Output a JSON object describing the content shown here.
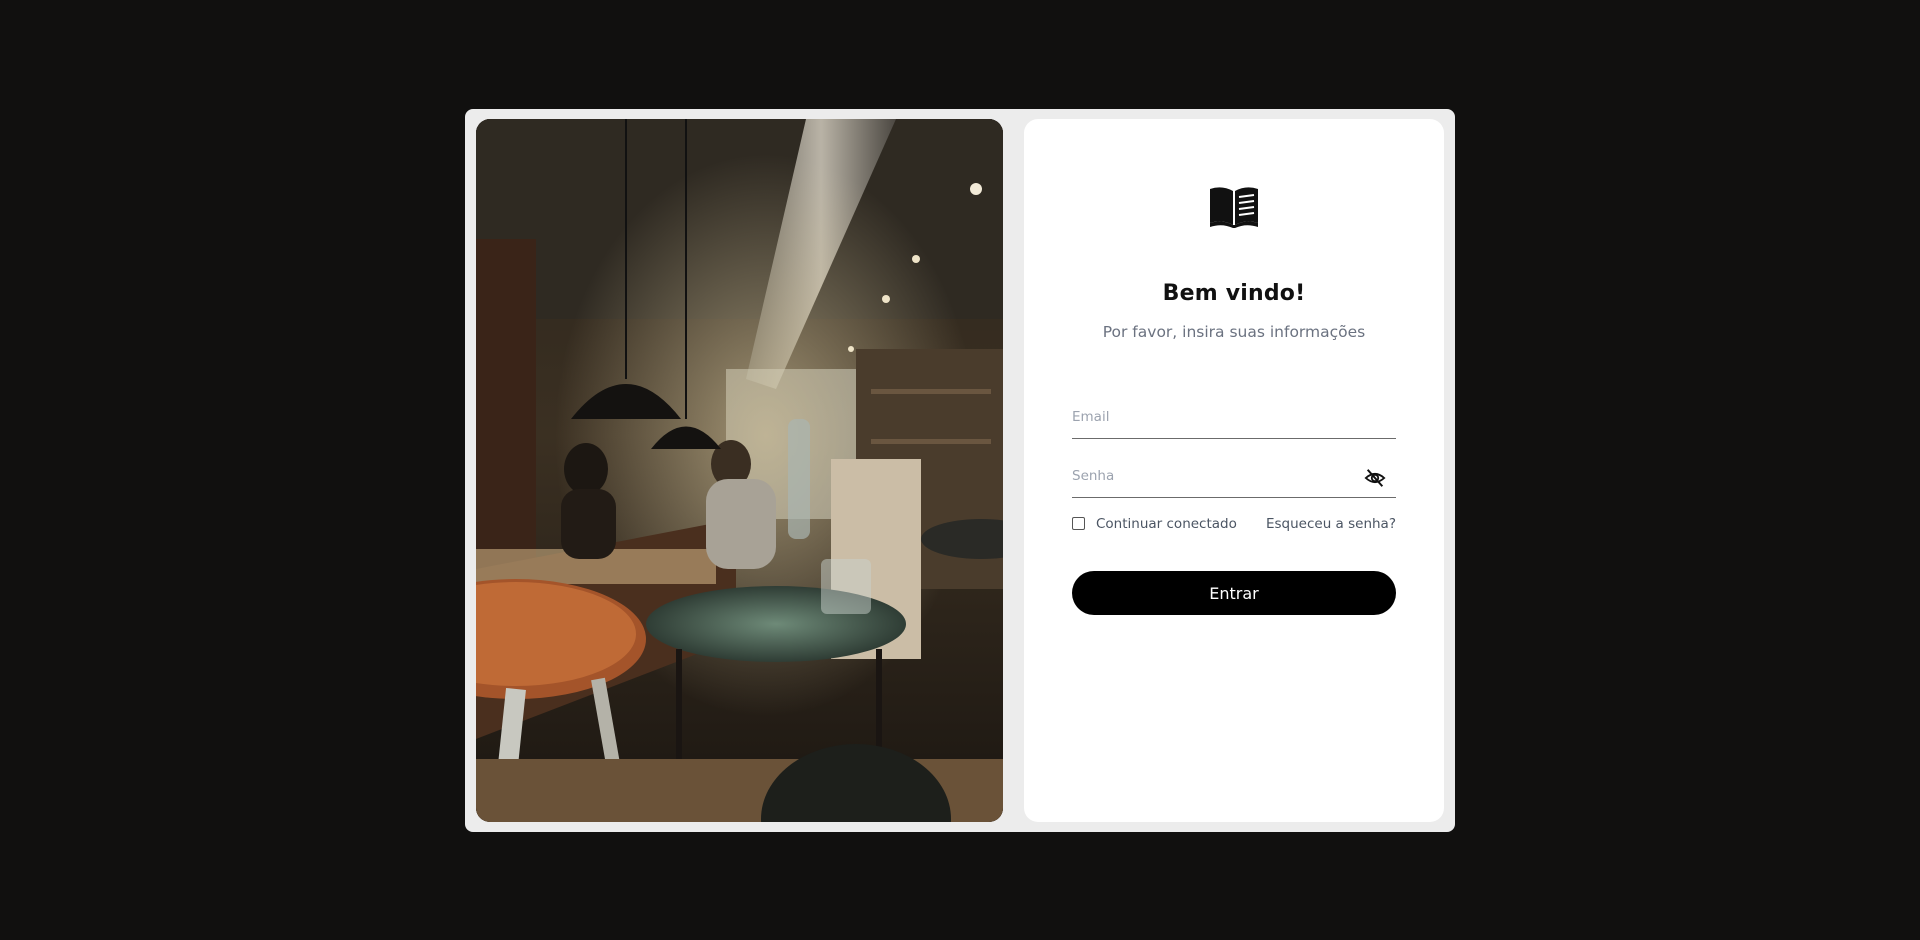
{
  "photo": {
    "description_icon": "cafe-photo"
  },
  "login": {
    "logo_icon": "open-book-icon",
    "title": "Bem vindo!",
    "subtitle": "Por favor, insira suas informações",
    "email": {
      "value": "",
      "placeholder": "Email"
    },
    "password": {
      "value": "",
      "placeholder": "Senha",
      "toggle_icon": "eye-slash-icon"
    },
    "remember": {
      "label": "Continuar conectado",
      "checked": false
    },
    "forgot_label": "Esqueceu a senha?",
    "submit_label": "Entrar"
  },
  "colors": {
    "background": "#11100f",
    "card": "#ececec",
    "panel": "#ffffff",
    "button": "#000000",
    "muted_text": "#6b7280"
  }
}
